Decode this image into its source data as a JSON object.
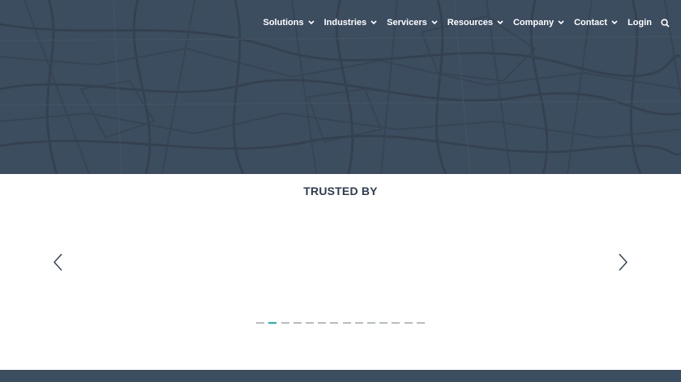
{
  "nav": {
    "items": [
      {
        "label": "Solutions",
        "icon": "chevron-down-icon"
      },
      {
        "label": "Industries",
        "icon": "chevron-down-icon"
      },
      {
        "label": "Servicers",
        "icon": "chevron-down-icon"
      },
      {
        "label": "Resources",
        "icon": "chevron-down-icon"
      },
      {
        "label": "Company",
        "icon": "chevron-down-icon"
      },
      {
        "label": "Contact",
        "icon": "chevron-down-icon"
      }
    ],
    "login_label": "Login",
    "search_icon": "search-icon"
  },
  "trusted": {
    "heading": "TRUSTED BY",
    "prev_icon": "chevron-left-icon",
    "next_icon": "chevron-right-icon",
    "slide_count": 14,
    "active_slide": 2
  },
  "colors": {
    "hero_bg": "#3d4d60",
    "heading": "#2e3d51",
    "dot": "#b6bcc3",
    "dot_active": "#1fb5a8",
    "footer_bg": "#3d4d60"
  }
}
